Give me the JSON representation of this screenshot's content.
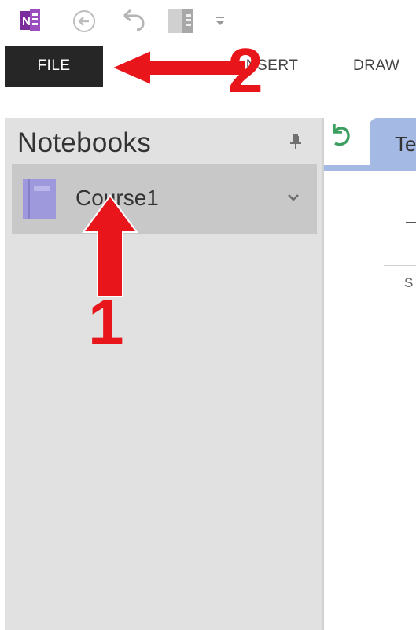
{
  "quick_access": {
    "app_icon": "onenote-icon",
    "back_icon": "back-arrow-icon",
    "undo_icon": "undo-icon",
    "dock_icon": "dock-to-desktop-icon",
    "customize_icon": "customize-toolbar-icon"
  },
  "ribbon": {
    "file_label": "FILE",
    "tabs": [
      {
        "label": "INSERT"
      },
      {
        "label": "DRAW"
      }
    ]
  },
  "nav": {
    "title": "Notebooks",
    "pin_icon": "pin-icon",
    "notebooks": [
      {
        "label": "Course1",
        "icon": "notebook-icon",
        "expand_icon": "chevron-down-icon"
      }
    ]
  },
  "sections": {
    "sync_icon": "sync-icon",
    "active_tab_label": "Te"
  },
  "page": {
    "title_fragment": "T",
    "date_fragment": "S"
  },
  "annotations": {
    "step1": "1",
    "step2": "2",
    "color": "#e8151b"
  },
  "colors": {
    "file_tab_bg": "#262626",
    "nav_bg": "#e1e1e1",
    "selected_notebook_bg": "#c8c8c8",
    "section_tab": "#a4b9e3",
    "onenote_purple": "#7b2d9e"
  }
}
